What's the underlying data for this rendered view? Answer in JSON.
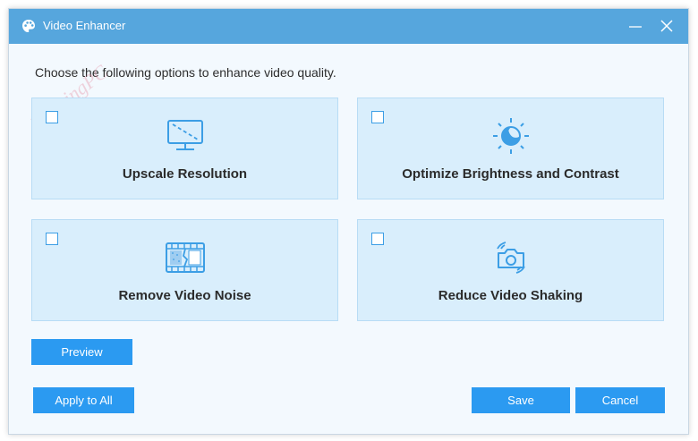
{
  "window": {
    "title": "Video Enhancer"
  },
  "prompt": "Choose the following options to enhance video quality.",
  "watermark": "WinningPC",
  "options": [
    {
      "label": "Upscale Resolution",
      "checked": false,
      "icon": "monitor-icon"
    },
    {
      "label": "Optimize Brightness and Contrast",
      "checked": false,
      "icon": "brightness-icon"
    },
    {
      "label": "Remove Video Noise",
      "checked": false,
      "icon": "film-noise-icon"
    },
    {
      "label": "Reduce Video Shaking",
      "checked": false,
      "icon": "shaking-camera-icon"
    }
  ],
  "buttons": {
    "preview": "Preview",
    "apply_all": "Apply to All",
    "save": "Save",
    "cancel": "Cancel"
  },
  "colors": {
    "titlebar": "#56a6dd",
    "button": "#2b9af1",
    "card": "#d9eefc",
    "icon": "#3c9ee5"
  }
}
